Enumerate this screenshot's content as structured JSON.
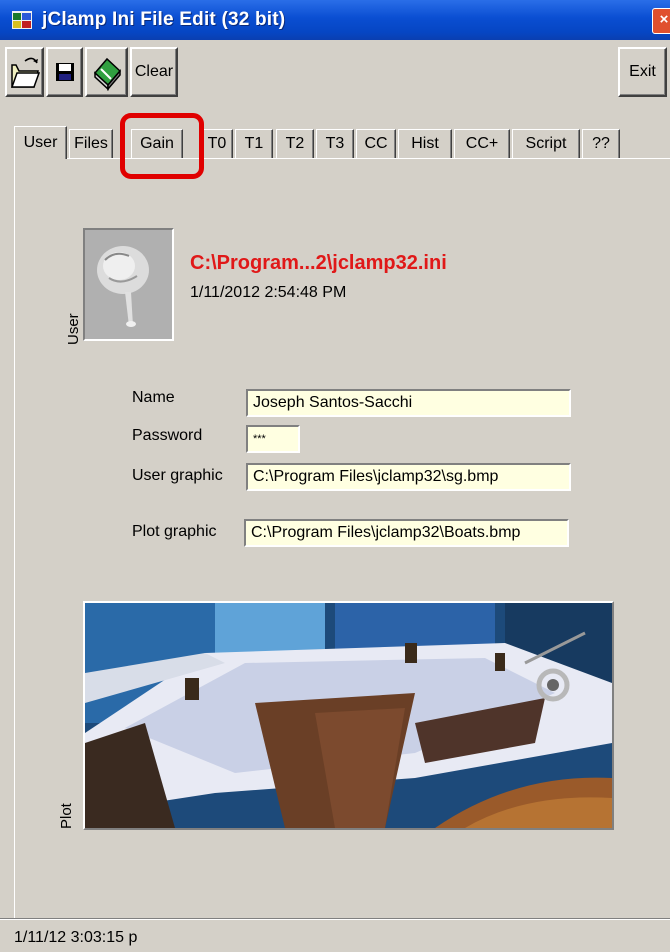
{
  "window": {
    "title": "jClamp Ini File Edit (32 bit)",
    "close_label": "×"
  },
  "toolbar": {
    "clear_label": "Clear",
    "exit_label": "Exit"
  },
  "tabs": [
    {
      "label": "User"
    },
    {
      "label": "Files"
    },
    {
      "label": "Gain"
    },
    {
      "label": "T0"
    },
    {
      "label": "T1"
    },
    {
      "label": "T2"
    },
    {
      "label": "T3"
    },
    {
      "label": "CC"
    },
    {
      "label": "Hist"
    },
    {
      "label": "CC+"
    },
    {
      "label": "Script"
    },
    {
      "label": "??"
    }
  ],
  "user_panel": {
    "file_path": "C:\\Program...2\\jclamp32.ini",
    "file_date": "1/11/2012 2:54:48 PM",
    "user_vertical_label": "User",
    "plot_vertical_label": "Plot",
    "fields": {
      "name_label": "Name",
      "name_value": "Joseph Santos-Sacchi",
      "password_label": "Password",
      "password_value": "***",
      "user_graphic_label": "User graphic",
      "user_graphic_value": "C:\\Program Files\\jclamp32\\sg.bmp",
      "plot_graphic_label": "Plot graphic",
      "plot_graphic_value": "C:\\Program Files\\jclamp32\\Boats.bmp"
    }
  },
  "status": {
    "text": "1/11/12 3:03:15 p"
  },
  "colors": {
    "title_bar": "#0a4ed2",
    "path_text": "#e01818",
    "field_bg": "#ffffe1",
    "highlight": "#e00000"
  }
}
